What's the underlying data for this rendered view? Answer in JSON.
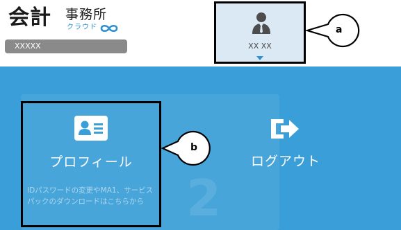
{
  "header": {
    "logo_main": "会計",
    "logo_sub": "事務所",
    "logo_tagline": "クラウド",
    "office_name": "XXXXX"
  },
  "user_menu": {
    "user_name": "XX XX",
    "callout_label": "a",
    "icon": "user-avatar-icon"
  },
  "menu": {
    "profile": {
      "title": "プロフィール",
      "description": "IDパスワードの変更やMA1、サービスパックのダウンロードはこちらから",
      "callout_label": "b",
      "icon": "profile-card-icon"
    },
    "logout": {
      "title": "ログアウト",
      "icon": "logout-icon"
    }
  },
  "colors": {
    "panel_bg": "#3a9fd8",
    "user_btn_bg": "#dbe9f4",
    "accent": "#2f8fd0",
    "office_bar": "#8a8a8a"
  }
}
